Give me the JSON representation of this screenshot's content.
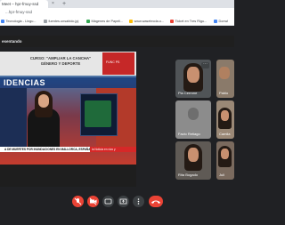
{
  "browser": {
    "tab_title": "Meet – hpr-fmuy-ssd",
    "tab_close": "×",
    "new_tab": "+",
    "url": "...hpr-fmuy-ssd",
    "bookmarks": [
      {
        "label": "Tecnologia - Lingu...",
        "color": "#4285f4"
      },
      {
        "label": "fuentes.unsabido.jpj",
        "color": "#9aa0a6"
      },
      {
        "label": "Mágenes de Papeli...",
        "color": "#34a853"
      },
      {
        "label": "www.wasetecda.o...",
        "color": "#fbbc05"
      },
      {
        "label": "Ticket en Tres Rigu...",
        "color": "#ea4335"
      },
      {
        "label": "Donwl",
        "color": "#4285f4"
      }
    ]
  },
  "meet": {
    "presenting_label": "esentando",
    "presentation": {
      "course_title_line1": "CURSO: \"AMPLIAR LA CANCHA\"",
      "course_title_line2": "GÉNERO Y DEPORTE",
      "red_box_text": "FUNC PS",
      "headline": "IDENCIAS",
      "ticker_text": "A DE MUERTES POR INUNDACIONES EN MALLORCA, ESPAÑA",
      "ticker_tag": "la Noticia en vivo y"
    },
    "participants": [
      {
        "name": "Pia Cerrone",
        "has_menu": true
      },
      {
        "name": "Pablo"
      },
      {
        "name": "Favio Retiago"
      },
      {
        "name": "Camila"
      },
      {
        "name": "Rita Bogado"
      },
      {
        "name": "Juli"
      }
    ],
    "controls": {
      "colors": {
        "end_call": "#ea4335",
        "mic_off": "#ea4335",
        "neutral": "#3c4043"
      }
    }
  }
}
